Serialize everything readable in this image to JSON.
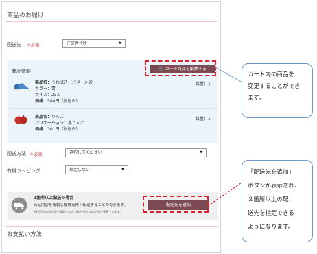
{
  "delivery": {
    "title": "商品のお届け",
    "address_label": "配送先",
    "required": "＊必須",
    "address_value": "注文者住所"
  },
  "items": {
    "header": "商品情報",
    "edit_button": "カート商品を編集する",
    "products": [
      {
        "lines": [
          {
            "key": "商品名：",
            "value": "うわばき（パターン2）"
          },
          {
            "key": "カラー：",
            "value": "青"
          },
          {
            "key": "サイズ：",
            "value": "23.0"
          },
          {
            "key": "価格：",
            "value": "580円（税込み）"
          }
        ],
        "quantity": "数量：1"
      },
      {
        "lines": [
          {
            "key": "商品名：",
            "value": "りんご"
          },
          {
            "key": "バリエーション：",
            "value": "赤りんご"
          },
          {
            "key": "価格：",
            "value": "301円（税込み）"
          }
        ],
        "quantity": "数量：1"
      }
    ]
  },
  "shipping": {
    "method_label": "配送方法",
    "required": "＊必須",
    "method_value": "選択してください",
    "wrapping_label": "有料ラッピング",
    "wrapping_value": "指定しない"
  },
  "multi": {
    "title": "2箇所以上配送の場合",
    "desc": "商品内容を複製し複数宛先へ配送することができます。",
    "note": "※1件目の商品内容を複製します。配送先別に商品内容が変更できます。",
    "add_button": "配送先を追加"
  },
  "payment": {
    "title": "お支払い方法"
  },
  "callouts": {
    "top": [
      "カート内の商品を",
      "変更することができ",
      "ます。"
    ],
    "bottom": [
      "「配送先を追加」",
      "ボタンが表示され、",
      "２箇所以上の配",
      "送先を指定できる",
      "ようになります。"
    ]
  },
  "colors": {
    "accent_button": "#7b4a52",
    "highlight_dash": "#d4232f",
    "required": "#d0303a",
    "items_bg": "#eaf4fa",
    "callout_border": "#6d95c4"
  }
}
